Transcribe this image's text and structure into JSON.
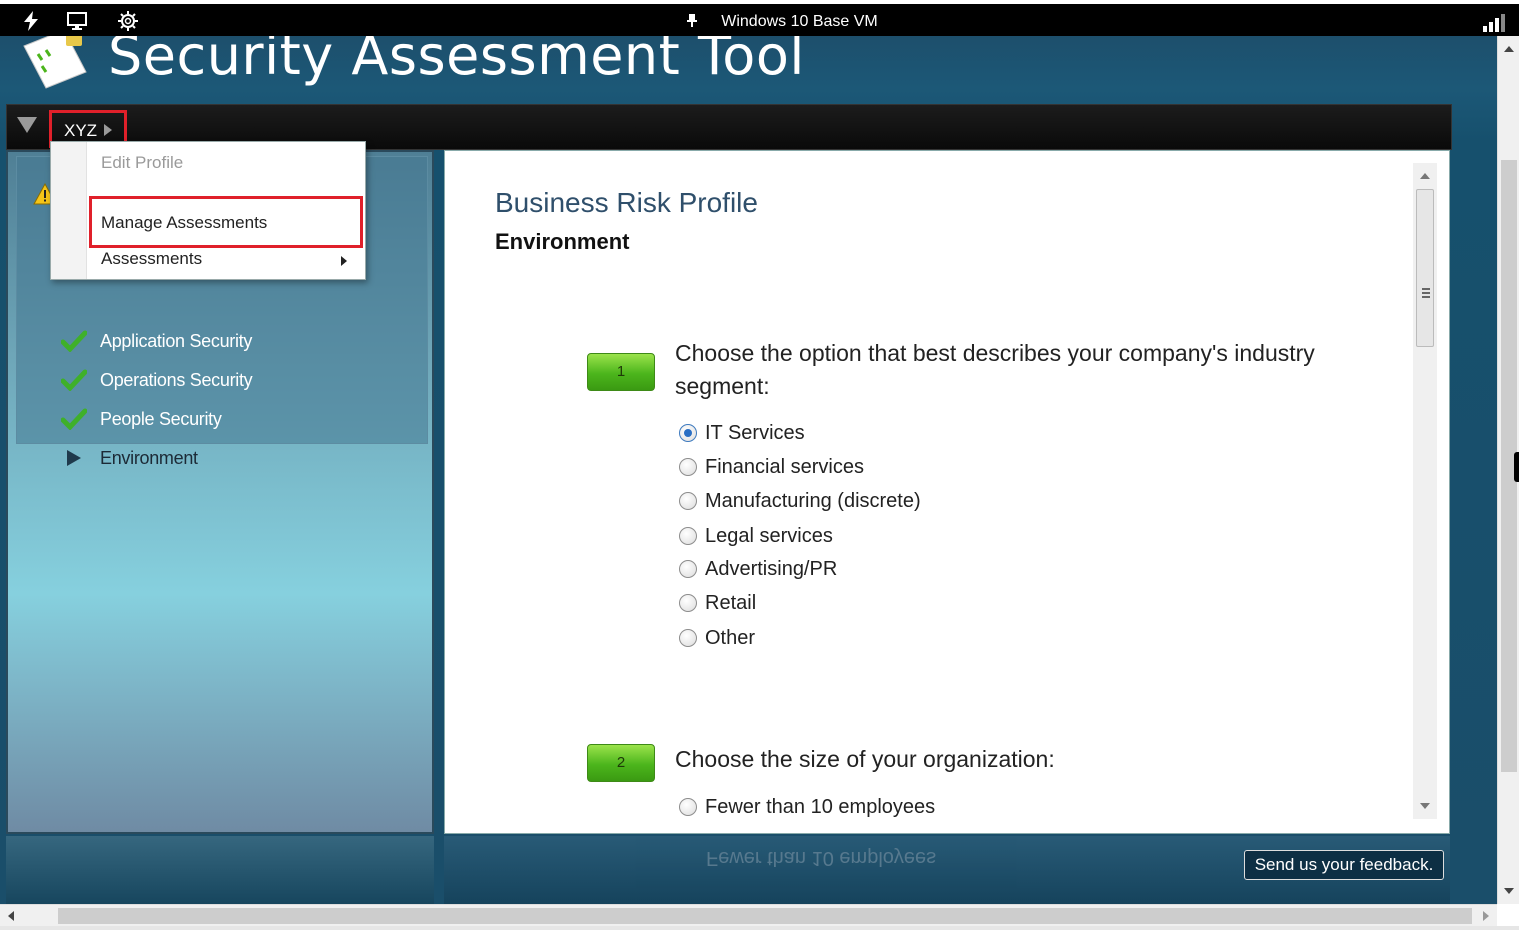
{
  "rdp": {
    "title": "Windows 10 Base VM",
    "icons": [
      "lightning-icon",
      "monitor-icon",
      "gear-icon",
      "pin-icon",
      "signal-icon"
    ]
  },
  "app": {
    "title": "Security Assessment Tool"
  },
  "breadcrumb": {
    "label": "XYZ"
  },
  "menu": {
    "items": [
      {
        "label": "Edit Profile",
        "enabled": false
      },
      {
        "label": "Manage Assessments",
        "enabled": true,
        "highlighted": true
      },
      {
        "label": "Assessments",
        "enabled": true,
        "has_submenu": true
      }
    ]
  },
  "nav": {
    "items": [
      {
        "label": "Application Security",
        "status": "complete"
      },
      {
        "label": "Operations Security",
        "status": "complete"
      },
      {
        "label": "People Security",
        "status": "complete"
      },
      {
        "label": "Environment",
        "status": "current"
      }
    ]
  },
  "main": {
    "title": "Business Risk Profile",
    "subtitle": "Environment",
    "questions": [
      {
        "number": "1",
        "text_line1": "Choose the option that best describes your company's industry",
        "text_line2": "segment:",
        "options": [
          "IT Services",
          "Financial services",
          "Manufacturing (discrete)",
          "Legal services",
          "Advertising/PR",
          "Retail",
          "Other"
        ],
        "selected": "IT Services"
      },
      {
        "number": "2",
        "text_line1": "Choose the size of your organization:",
        "options": [
          "Fewer than 10 employees"
        ],
        "selected": null
      }
    ]
  },
  "reflection_text": "Fewer than 10 employees",
  "feedback_label": "Send us your feedback.",
  "colors": {
    "highlight_red": "#e0202a",
    "accent_green": "#4cb51c",
    "title_blue": "#2f4f6b"
  }
}
